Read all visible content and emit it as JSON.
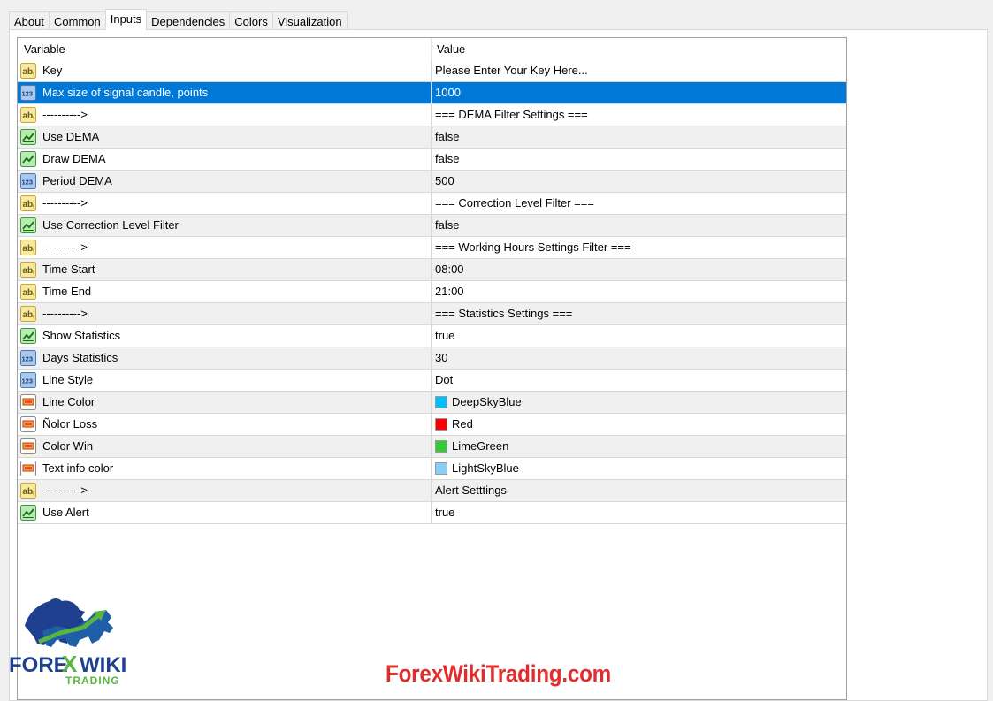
{
  "tabs": [
    {
      "label": "About"
    },
    {
      "label": "Common"
    },
    {
      "label": "Inputs",
      "active": true
    },
    {
      "label": "Dependencies"
    },
    {
      "label": "Colors"
    },
    {
      "label": "Visualization"
    }
  ],
  "table": {
    "columns": {
      "variable": "Variable",
      "value": "Value"
    },
    "rows": [
      {
        "icon": "string-icon",
        "variable": "Key",
        "value": "Please Enter Your Key Here..."
      },
      {
        "icon": "number-icon",
        "variable": "Max size of signal candle, points",
        "value": "1000",
        "selected": true
      },
      {
        "icon": "string-icon",
        "variable": "---------->",
        "value": "=== DEMA Filter Settings ==="
      },
      {
        "icon": "bool-icon",
        "variable": "Use DEMA",
        "value": "false"
      },
      {
        "icon": "bool-icon",
        "variable": "Draw DEMA",
        "value": "false"
      },
      {
        "icon": "number-icon",
        "variable": "Period DEMA",
        "value": "500"
      },
      {
        "icon": "string-icon",
        "variable": "---------->",
        "value": "=== Correction Level Filter ==="
      },
      {
        "icon": "bool-icon",
        "variable": "Use Correction Level Filter",
        "value": "false"
      },
      {
        "icon": "string-icon",
        "variable": "---------->",
        "value": "=== Working Hours Settings Filter ==="
      },
      {
        "icon": "string-icon",
        "variable": "Time Start",
        "value": "08:00"
      },
      {
        "icon": "string-icon",
        "variable": "Time End",
        "value": "21:00"
      },
      {
        "icon": "string-icon",
        "variable": "---------->",
        "value": "=== Statistics Settings ==="
      },
      {
        "icon": "bool-icon",
        "variable": "Show Statistics",
        "value": "true"
      },
      {
        "icon": "number-icon",
        "variable": "Days Statistics",
        "value": "30"
      },
      {
        "icon": "number-icon",
        "variable": "Line Style",
        "value": "Dot"
      },
      {
        "icon": "color-icon",
        "variable": "Line Color",
        "value": "DeepSkyBlue",
        "swatch": "#00bfff"
      },
      {
        "icon": "color-icon",
        "variable": "Ñolor Loss",
        "value": "Red",
        "swatch": "#ff0000"
      },
      {
        "icon": "color-icon",
        "variable": "Color Win",
        "value": "LimeGreen",
        "swatch": "#32cd32"
      },
      {
        "icon": "color-icon",
        "variable": "Text info color",
        "value": "LightSkyBlue",
        "swatch": "#87cefa"
      },
      {
        "icon": "string-icon",
        "variable": "---------->",
        "value": "Alert Setttings"
      },
      {
        "icon": "bool-icon",
        "variable": "Use Alert",
        "value": "true"
      }
    ]
  },
  "logo": {
    "line1a": "FORE",
    "line1b": "X",
    "line1c": "WIKI",
    "line2": "TRADING"
  },
  "watermark": "ForexWikiTrading.com",
  "colors": {
    "selection": "#0078d7",
    "watermark": "#e32c2c",
    "logo_blue": "#1f3f8f",
    "logo_green": "#5ab53f"
  }
}
